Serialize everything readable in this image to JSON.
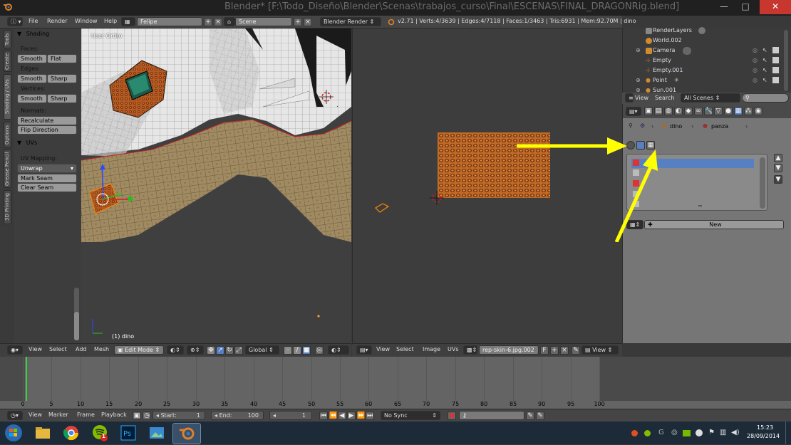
{
  "window": {
    "title": "Blender* [F:\\Todo_Diseño\\Blender\\Scenas\\trabajos_curso\\Final\\ESCENAS\\FINAL_DRAGONRig.blend]",
    "minimize": "—",
    "maximize": "□",
    "close": "✕"
  },
  "topbar": {
    "menus": [
      "File",
      "Render",
      "Window",
      "Help"
    ],
    "screen_layout": "Felipe",
    "scene": "Scene",
    "engine": "Blender Render",
    "stats": "v2.71 | Verts:4/3639 | Edges:4/7118 | Faces:1/3463 | Tris:6931 | Mem:92.70M | dino"
  },
  "toolshelf": {
    "tabs": [
      "Tools",
      "Create",
      "Shading / UVs",
      "Options",
      "Grease Pencil",
      "3D Printing"
    ],
    "shading_panel": "Shading",
    "faces_label": "Faces:",
    "smooth": "Smooth",
    "flat": "Flat",
    "edges_label": "Edges:",
    "sharp": "Sharp",
    "vertices_label": "Vertices:",
    "normals_label": "Normals:",
    "recalculate": "Recalculate",
    "flip_direction": "Flip Direction",
    "uvs_panel": "UVs",
    "uv_mapping_label": "UV Mapping:",
    "unwrap": "Unwrap",
    "mark_seam": "Mark Seam",
    "clear_seam": "Clear Seam"
  },
  "viewport3d": {
    "view_label": "User Ortho",
    "object_label": "(1) dino",
    "header": {
      "menus": [
        "View",
        "Select",
        "Add",
        "Mesh"
      ],
      "mode": "Edit Mode",
      "orientation": "Global"
    }
  },
  "uv_editor": {
    "header": {
      "menus": [
        "View",
        "Select",
        "Image",
        "UVs"
      ],
      "image": "rep-skin-6.jpg.002",
      "fake_user": "F",
      "view": "View"
    }
  },
  "outliner": {
    "rows": [
      {
        "label": "RenderLayers",
        "icon": "render-layers-icon"
      },
      {
        "label": "World.002",
        "icon": "world-icon"
      },
      {
        "label": "Camera",
        "icon": "camera-icon"
      },
      {
        "label": "Empty",
        "icon": "empty-icon"
      },
      {
        "label": "Empty.001",
        "icon": "empty-icon"
      },
      {
        "label": "Point",
        "icon": "lamp-icon"
      },
      {
        "label": "Sun.001",
        "icon": "lamp-icon"
      }
    ],
    "header": {
      "view": "View",
      "search": "Search",
      "filter": "All Scenes"
    }
  },
  "properties": {
    "breadcrumb": [
      "dino",
      "panza"
    ],
    "new_button": "New"
  },
  "timeline": {
    "ticks": [
      "0",
      "5",
      "10",
      "15",
      "20",
      "25",
      "30",
      "35",
      "40",
      "45",
      "50",
      "55",
      "60",
      "65",
      "70",
      "75",
      "80",
      "85",
      "90",
      "95",
      "100"
    ],
    "header": {
      "menus": [
        "View",
        "Marker",
        "Frame",
        "Playback"
      ],
      "start": "Start:",
      "start_value": "1",
      "end": "End:",
      "end_value": "100",
      "current": "1",
      "sync": "No Sync"
    }
  },
  "taskbar": {
    "time": "15:23",
    "date": "28/09/2014",
    "spotify_badge": "1"
  },
  "colors": {
    "arrow": "#ffff00",
    "selection": "#5680c2",
    "titlebar_close": "#c7372f"
  }
}
